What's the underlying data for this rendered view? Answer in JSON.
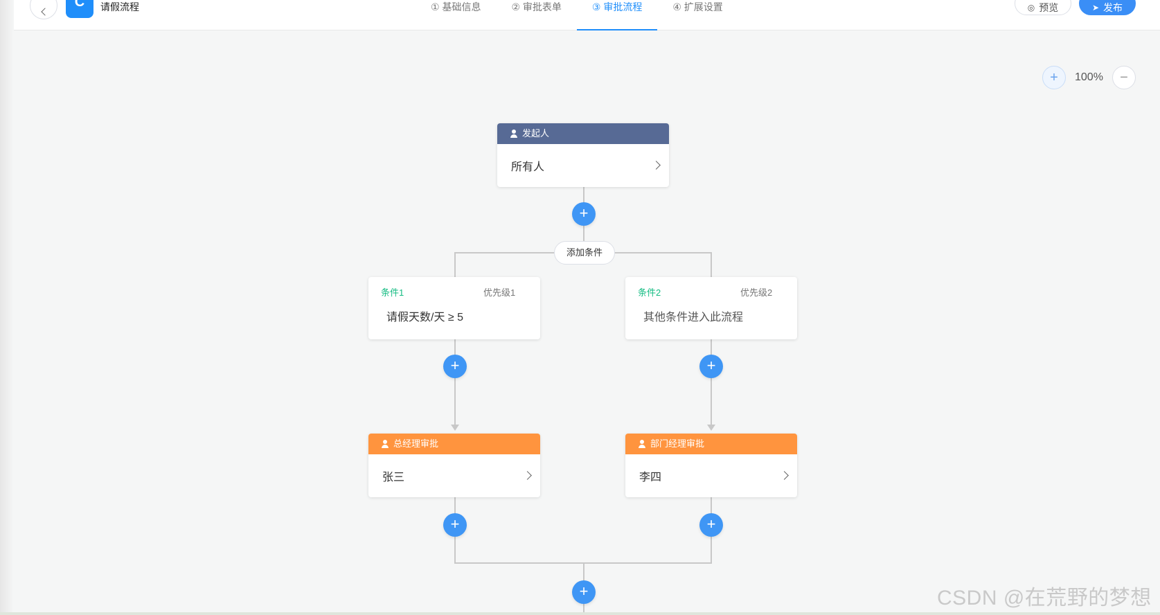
{
  "header": {
    "back_icon": "chevron-left-icon",
    "app_logo_text": "C",
    "title": "请假流程",
    "steps": [
      {
        "label": "① 基础信息",
        "active": false
      },
      {
        "label": "② 审批表单",
        "active": false
      },
      {
        "label": "③ 审批流程",
        "active": true
      },
      {
        "label": "④ 扩展设置",
        "active": false
      }
    ],
    "preview_label": "预览",
    "publish_label": "发布",
    "accent_color": "#1f8efa"
  },
  "zoom": {
    "zoom_in_symbol": "+",
    "level": "100%",
    "zoom_out_symbol": "−"
  },
  "flow": {
    "start_node": {
      "title": "发起人",
      "value": "所有人",
      "color": "#576a95"
    },
    "add_condition_label": "添加条件",
    "add_symbol": "+",
    "conditions": [
      {
        "name": "条件1",
        "priority": "优先级1",
        "content": "请假天数/天 ≥ 5"
      },
      {
        "name": "条件2",
        "priority": "优先级2",
        "content": "其他条件进入此流程"
      }
    ],
    "approvers": [
      {
        "title": "总经理审批",
        "value": "张三",
        "color": "#ff943e"
      },
      {
        "title": "部门经理审批",
        "value": "李四",
        "color": "#ff943e"
      }
    ]
  },
  "watermark": "CSDN @在荒野的梦想"
}
